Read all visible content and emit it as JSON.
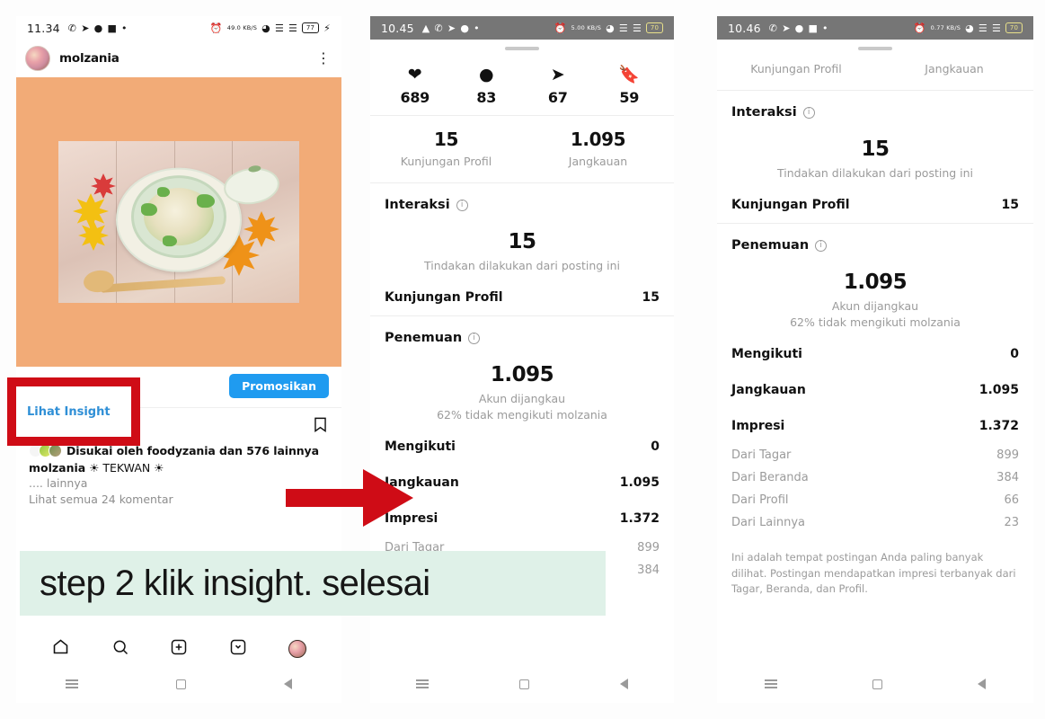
{
  "phone1": {
    "status": {
      "time": "11.34",
      "data_rate": "49.0 KB/S",
      "battery": "77"
    },
    "post": {
      "username": "molzania",
      "menu_icon": "more-vertical-icon",
      "insight_link": "Lihat Insight",
      "promote_button": "Promosikan",
      "likes_text": "Disukai oleh foodyzania dan 576 lainnya",
      "caption_user": "molzania",
      "caption_text": "☀ TEKWAN ☀",
      "more_text": ".... lainnya",
      "comments_text": "Lihat semua 24 komentar"
    },
    "navbar": [
      "home-icon",
      "search-icon",
      "add-post-icon",
      "reels-icon",
      "profile-avatar"
    ]
  },
  "phone2": {
    "status": {
      "time": "10.45",
      "data_rate": "5.00 KB/S",
      "battery": "70"
    },
    "engagement": [
      {
        "icon": "heart-icon",
        "value": "689"
      },
      {
        "icon": "comment-icon",
        "value": "83"
      },
      {
        "icon": "share-icon",
        "value": "67"
      },
      {
        "icon": "bookmark-icon",
        "value": "59"
      }
    ],
    "summary": [
      {
        "value": "15",
        "label": "Kunjungan Profil"
      },
      {
        "value": "1.095",
        "label": "Jangkauan"
      }
    ],
    "interaksi": {
      "title": "Interaksi",
      "big_value": "15",
      "big_sub": "Tindakan dilakukan dari posting ini",
      "rows": [
        {
          "label": "Kunjungan Profil",
          "value": "15"
        }
      ]
    },
    "penemuan": {
      "title": "Penemuan",
      "big_value": "1.095",
      "big_sub_line1": "Akun dijangkau",
      "big_sub_line2": "62% tidak mengikuti molzania",
      "rows": [
        {
          "label": "Mengikuti",
          "value": "0"
        },
        {
          "label": "Jangkauan",
          "value": "1.095"
        },
        {
          "label": "Impresi",
          "value": "1.372"
        },
        {
          "label": "Dari Tagar",
          "value": "899"
        },
        {
          "label": "Dari Beranda",
          "value": "384"
        }
      ]
    }
  },
  "phone3": {
    "status": {
      "time": "10.46",
      "data_rate": "0.77 KB/S",
      "battery": "70"
    },
    "tabs": [
      {
        "label": "Kunjungan Profil"
      },
      {
        "label": "Jangkauan"
      }
    ],
    "interaksi": {
      "title": "Interaksi",
      "big_value": "15",
      "big_sub": "Tindakan dilakukan dari posting ini",
      "rows": [
        {
          "label": "Kunjungan Profil",
          "value": "15"
        }
      ]
    },
    "penemuan": {
      "title": "Penemuan",
      "big_value": "1.095",
      "big_sub_line1": "Akun dijangkau",
      "big_sub_line2": "62% tidak mengikuti molzania",
      "rows": [
        {
          "label": "Mengikuti",
          "value": "0"
        },
        {
          "label": "Jangkauan",
          "value": "1.095"
        },
        {
          "label": "Impresi",
          "value": "1.372"
        }
      ],
      "sub_rows": [
        {
          "label": "Dari Tagar",
          "value": "899"
        },
        {
          "label": "Dari Beranda",
          "value": "384"
        },
        {
          "label": "Dari Profil",
          "value": "66"
        },
        {
          "label": "Dari Lainnya",
          "value": "23"
        }
      ],
      "footnote": "Ini adalah tempat postingan Anda paling banyak dilihat. Postingan mendapatkan impresi terbanyak dari Tagar, Beranda, dan Profil."
    }
  },
  "annotations": {
    "highlight_label": "Lihat Insight",
    "banner_text": "step 2 klik insight. selesai",
    "arrow_icon": "right-arrow-icon",
    "highlight_color": "#cf0c16",
    "banner_bg": "#dff1e8",
    "accent_blue": "#1f9bf0"
  }
}
